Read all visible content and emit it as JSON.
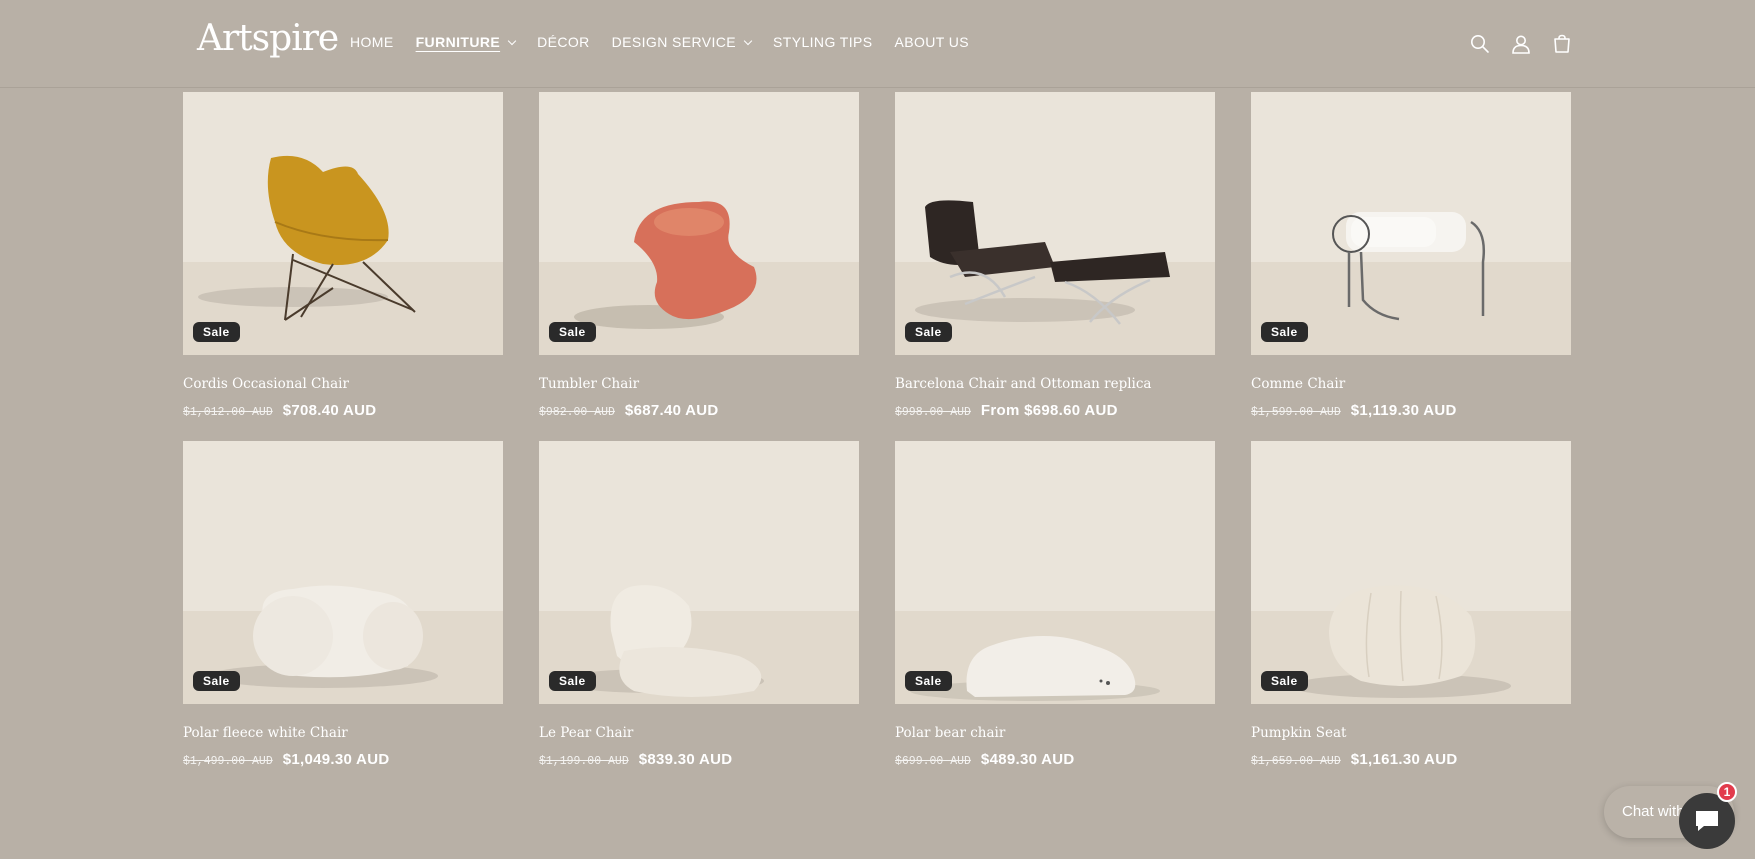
{
  "header": {
    "logo": "Artspire",
    "nav": [
      {
        "label": "HOME"
      },
      {
        "label": "FURNITURE",
        "active": true,
        "dropdown": true
      },
      {
        "label": "DÉCOR"
      },
      {
        "label": "DESIGN SERVICE",
        "dropdown": true
      },
      {
        "label": "STYLING TIPS"
      },
      {
        "label": "ABOUT US"
      }
    ],
    "icons": [
      "search-icon",
      "account-icon",
      "cart-icon"
    ]
  },
  "products": [
    {
      "title": "Cordis Occasional Chair",
      "old_price": "$1,012.00 AUD",
      "price": "$708.40 AUD",
      "badge": "Sale"
    },
    {
      "title": "Tumbler Chair",
      "old_price": "$982.00 AUD",
      "price": "$687.40 AUD",
      "badge": "Sale"
    },
    {
      "title": "Barcelona Chair and Ottoman replica",
      "old_price": "$998.00 AUD",
      "price": "From $698.60 AUD",
      "badge": "Sale"
    },
    {
      "title": "Comme Chair",
      "old_price": "$1,599.00 AUD",
      "price": "$1,119.30 AUD",
      "badge": "Sale"
    },
    {
      "title": "Polar fleece white Chair",
      "old_price": "$1,499.00 AUD",
      "price": "$1,049.30 AUD",
      "badge": "Sale"
    },
    {
      "title": "Le Pear Chair",
      "old_price": "$1,199.00 AUD",
      "price": "$839.30 AUD",
      "badge": "Sale"
    },
    {
      "title": "Polar bear chair",
      "old_price": "$699.00 AUD",
      "price": "$489.30 AUD",
      "badge": "Sale"
    },
    {
      "title": "Pumpkin Seat",
      "old_price": "$1,659.00 AUD",
      "price": "$1,161.30 AUD",
      "badge": "Sale"
    }
  ],
  "chat": {
    "label": "Chat with",
    "badge_count": "1"
  },
  "colors": {
    "background": "#b8b0a6",
    "badge": "#2a2a2a",
    "chat_badge": "#e23b4c"
  }
}
